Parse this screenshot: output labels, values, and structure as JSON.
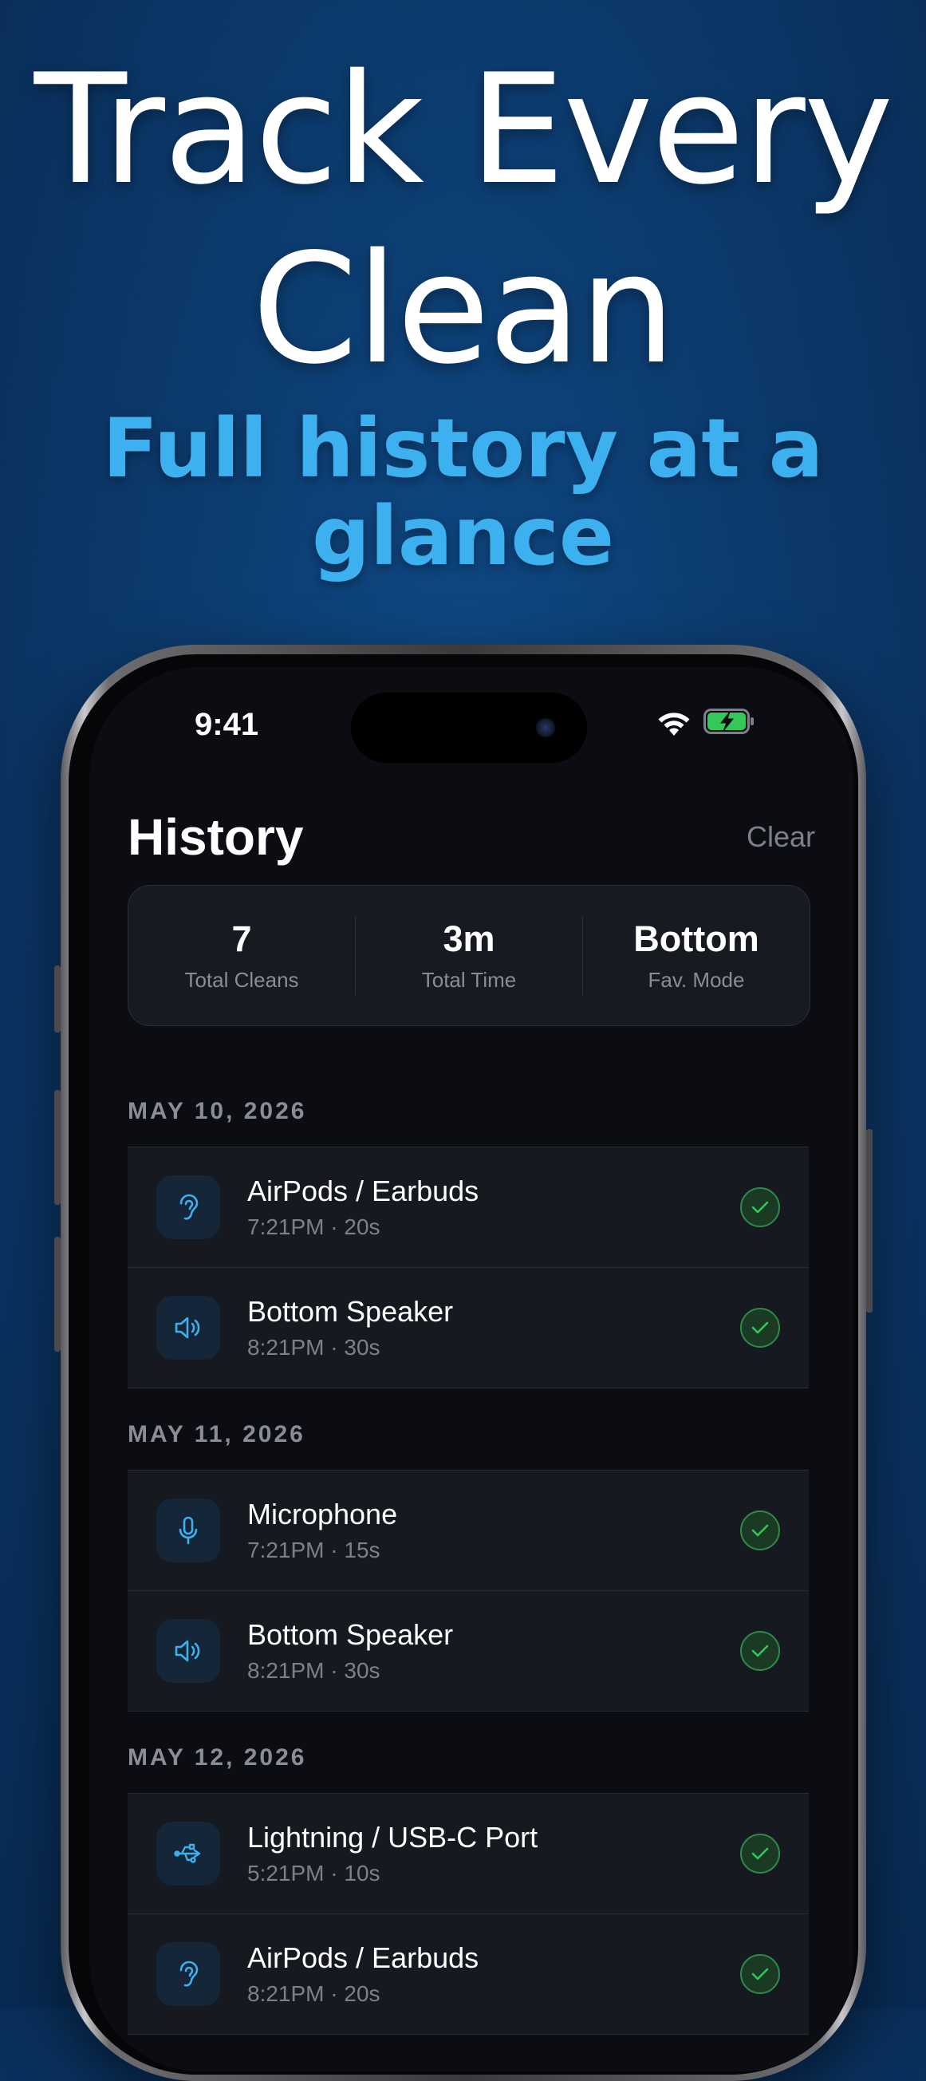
{
  "headline": {
    "line1": "Track Every",
    "line2": "Clean"
  },
  "subhead": {
    "line1": "Full history at a",
    "line2": "glance"
  },
  "status_bar": {
    "time": "9:41"
  },
  "header": {
    "title": "History",
    "clear_label": "Clear"
  },
  "stats": [
    {
      "value": "7",
      "label": "Total Cleans"
    },
    {
      "value": "3m",
      "label": "Total Time"
    },
    {
      "value": "Bottom",
      "label": "Fav. Mode"
    }
  ],
  "groups": [
    {
      "date": "MAY 10, 2026",
      "items": [
        {
          "title": "AirPods / Earbuds",
          "subtitle": "7:21PM · 20s",
          "icon": "ear-icon"
        },
        {
          "title": "Bottom Speaker",
          "subtitle": "8:21PM · 30s",
          "icon": "speaker-icon"
        }
      ]
    },
    {
      "date": "MAY 11, 2026",
      "items": [
        {
          "title": "Microphone",
          "subtitle": "7:21PM · 15s",
          "icon": "microphone-icon"
        },
        {
          "title": "Bottom Speaker",
          "subtitle": "8:21PM · 30s",
          "icon": "speaker-icon"
        }
      ]
    },
    {
      "date": "MAY 12, 2026",
      "items": [
        {
          "title": "Lightning / USB-C Port",
          "subtitle": "5:21PM · 10s",
          "icon": "usb-icon"
        },
        {
          "title": "AirPods / Earbuds",
          "subtitle": "8:21PM · 20s",
          "icon": "ear-icon"
        }
      ]
    }
  ],
  "colors": {
    "accent": "#3db0ef",
    "success": "#34c759",
    "background": "#0b0d12"
  }
}
